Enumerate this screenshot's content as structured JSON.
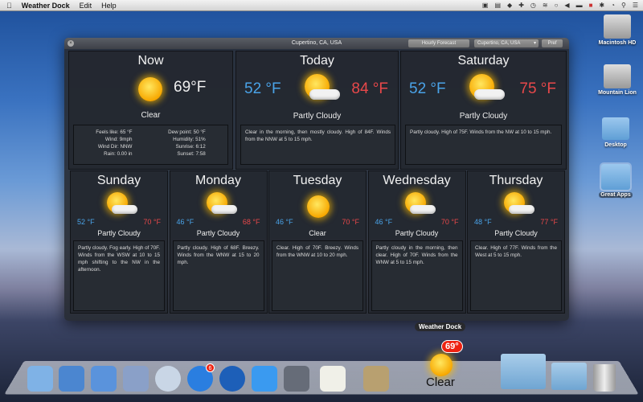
{
  "menubar": {
    "app": "Weather Dock",
    "items": [
      "Edit",
      "Help"
    ],
    "tray_icons": [
      "screen-icon",
      "doc-icon",
      "evernote-icon",
      "dropbox-icon",
      "time-machine-icon",
      "wifi-icon",
      "sync-icon",
      "volume-icon",
      "battery-icon",
      "flag-icon",
      "bluetooth-icon",
      "clock-icon",
      "spotlight-icon",
      "list-icon"
    ]
  },
  "window": {
    "title": "Cupertino, CA, USA",
    "hourly_button": "Hourly Forecast",
    "location_select": "Cupertino, CA, USA",
    "pref_button": "Pref"
  },
  "now": {
    "title": "Now",
    "temp": "69°F",
    "condition": "Clear",
    "details_left": [
      "Feels like: 65 °F",
      "Wind: 9mph",
      "Wind Dir: NNW",
      "Rain: 0.00 in"
    ],
    "details_right": [
      "Dew point: 50 °F",
      "Humidity: 51%",
      "Sunrise: 6:12",
      "Sunset: 7:58"
    ]
  },
  "days_top": [
    {
      "title": "Today",
      "low": "52 °F",
      "high": "84 °F",
      "condition": "Partly Cloudy",
      "desc": "Clear in the morning, then mostly cloudy. High of 84F. Winds from the NNW at 5 to 15 mph."
    },
    {
      "title": "Saturday",
      "low": "52 °F",
      "high": "75 °F",
      "condition": "Partly Cloudy",
      "desc": "Partly cloudy. High of 75F. Winds from the NW at 10 to 15 mph."
    }
  ],
  "days": [
    {
      "title": "Sunday",
      "low": "52 °F",
      "high": "70 °F",
      "condition": "Partly Cloudy",
      "icon": "partly-cloudy",
      "desc": "Partly cloudy. Fog early. High of 70F. Winds from the WSW at 10 to 15 mph shifting to the NW in the afternoon."
    },
    {
      "title": "Monday",
      "low": "46 °F",
      "high": "68 °F",
      "condition": "Partly Cloudy",
      "icon": "partly-cloudy",
      "desc": "Partly cloudy. High of 68F. Breezy. Winds from the WNW at 15 to 20 mph."
    },
    {
      "title": "Tuesday",
      "low": "46 °F",
      "high": "70 °F",
      "condition": "Clear",
      "icon": "sun",
      "desc": "Clear. High of 70F. Breezy. Winds from the WNW at 10 to 20 mph."
    },
    {
      "title": "Wednesday",
      "low": "46 °F",
      "high": "70 °F",
      "condition": "Partly Cloudy",
      "icon": "partly-cloudy",
      "desc": "Partly cloudy in the morning, then clear. High of 70F. Winds from the WNW at 5 to 15 mph."
    },
    {
      "title": "Thursday",
      "low": "48 °F",
      "high": "77 °F",
      "condition": "Partly Cloudy",
      "icon": "partly-cloudy",
      "desc": "Clear. High of 77F. Winds from the West at 5 to 15 mph."
    }
  ],
  "desktop_icons": [
    "Macintosh HD",
    "Mountain Lion",
    "Desktop",
    "Great Apps"
  ],
  "dock": {
    "tooltip": "Weather Dock",
    "weather_badge": "69°",
    "weather_label": "Clear",
    "appstore_badge": "6",
    "apps": [
      "finder",
      "xcode",
      "ios-simulator",
      "mail",
      "safari",
      "app-store",
      "itunes",
      "messages",
      "facetime",
      "maps",
      "preview"
    ]
  }
}
